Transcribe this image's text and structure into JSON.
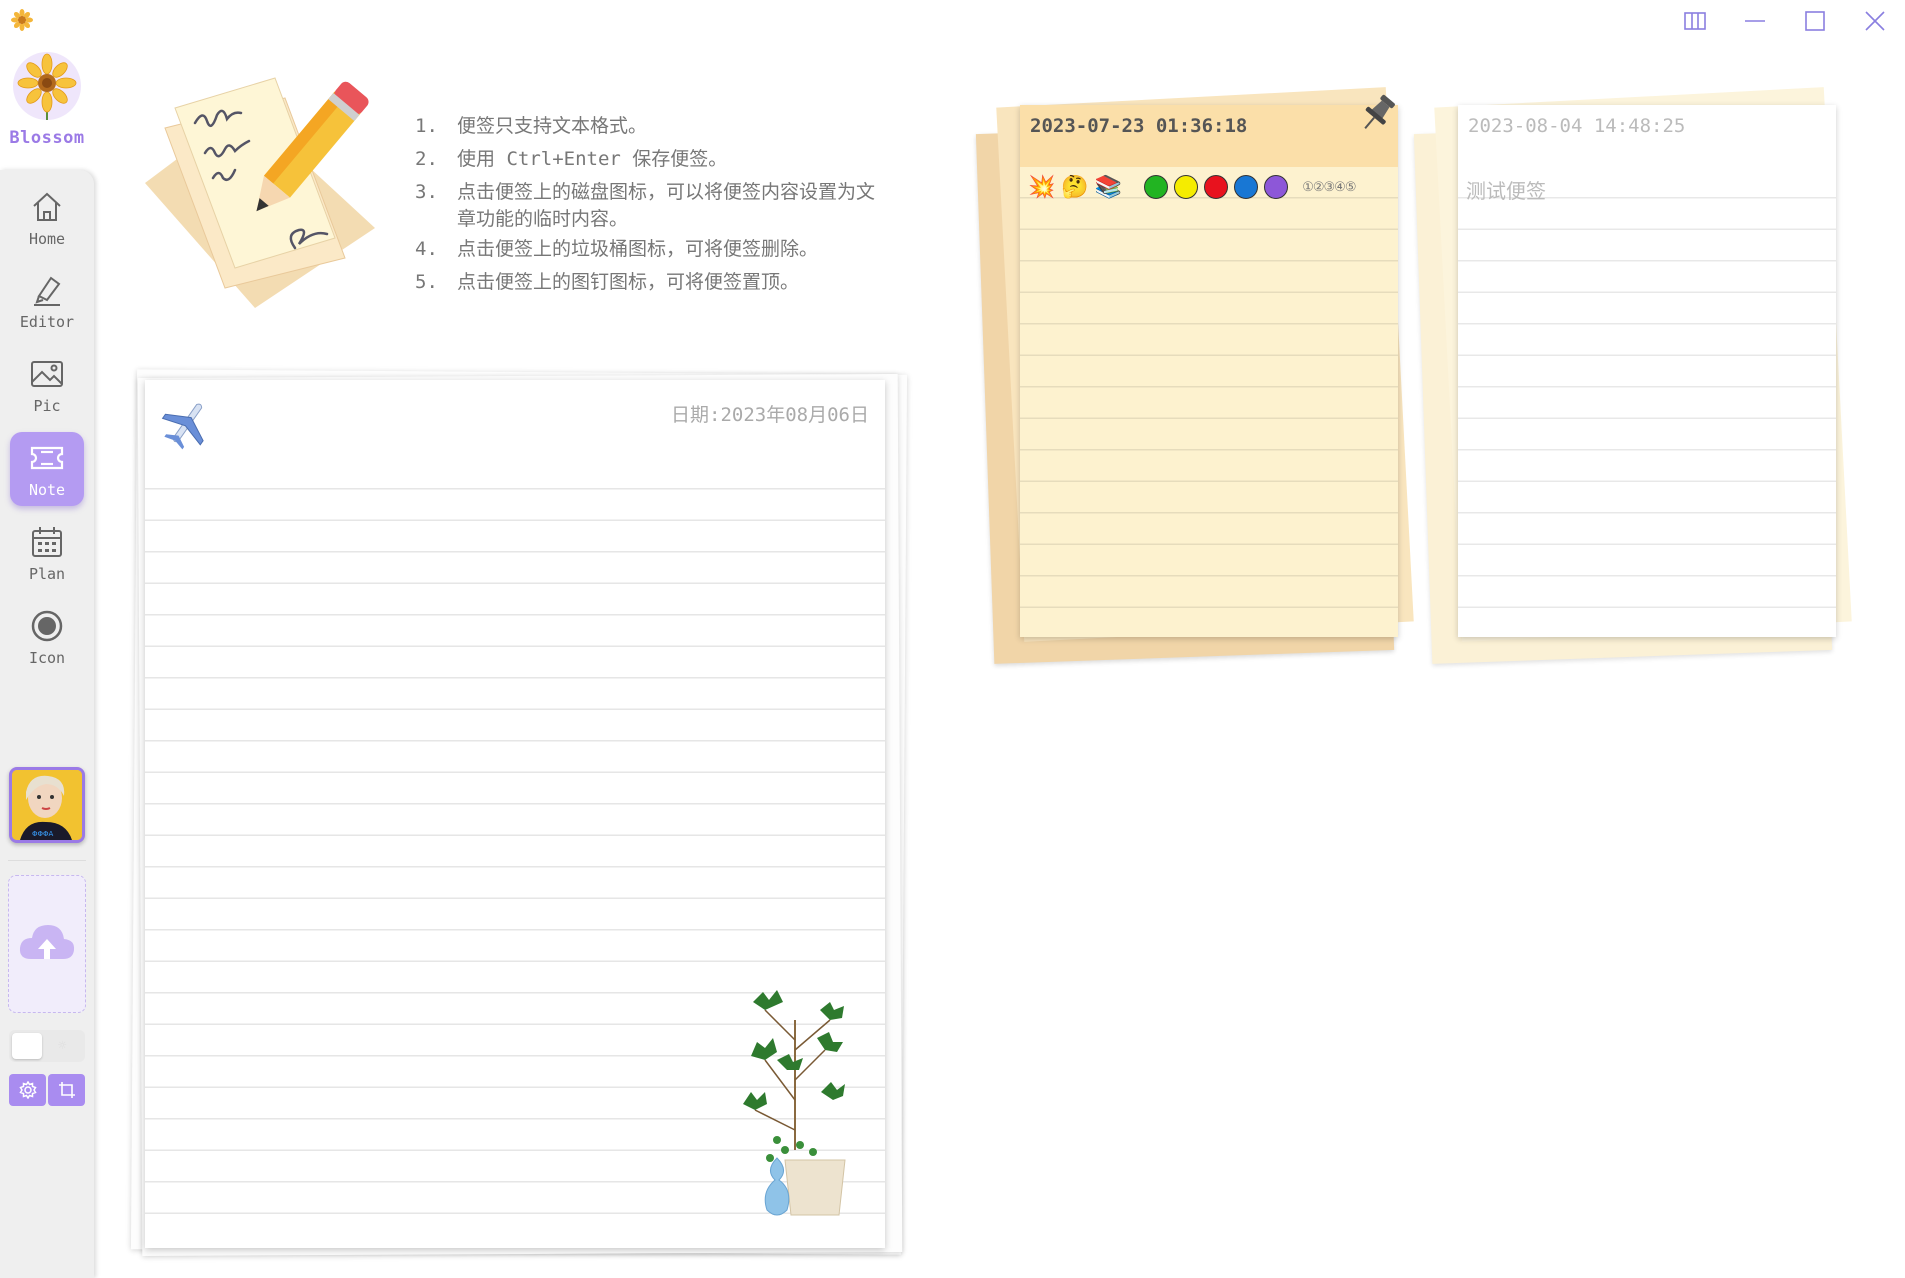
{
  "app": {
    "name": "Blossom",
    "window_controls": [
      "layout-icon",
      "minimize-icon",
      "maximize-icon",
      "close-icon"
    ]
  },
  "sidebar": {
    "items": [
      {
        "label": "Home",
        "icon": "home-icon",
        "active": false
      },
      {
        "label": "Editor",
        "icon": "pen-icon",
        "active": false
      },
      {
        "label": "Pic",
        "icon": "image-icon",
        "active": false
      },
      {
        "label": "Note",
        "icon": "ticket-icon",
        "active": true
      },
      {
        "label": "Plan",
        "icon": "calendar-icon",
        "active": false
      },
      {
        "label": "Icon",
        "icon": "record-icon",
        "active": false
      }
    ],
    "upload_icon": "cloud-upload-icon",
    "theme_icon": "sun-icon",
    "bottom_buttons": [
      "settings-icon",
      "crop-icon"
    ]
  },
  "tips": [
    {
      "num": "1.",
      "text": "便签只支持文本格式。"
    },
    {
      "num": "2.",
      "text": "使用 Ctrl+Enter 保存便签。"
    },
    {
      "num": "3.",
      "text": "点击便签上的磁盘图标，可以将便签内容设置为文章功能的临时内容。"
    },
    {
      "num": "4.",
      "text": "点击便签上的垃圾桶图标，可将便签删除。"
    },
    {
      "num": "5.",
      "text": "点击便签上的图钉图标，可将便签置顶。"
    }
  ],
  "editor_note": {
    "date_text": "日期:2023年08月06日",
    "icon": "airplane-icon",
    "decoration": "plant-image"
  },
  "notes": [
    {
      "timestamp": "2023-07-23 01:36:18",
      "pinned": true,
      "emoji": [
        "💥",
        "🤔",
        "📚"
      ],
      "colors": [
        "#22b422",
        "#f5ec00",
        "#e8121e",
        "#1877d4",
        "#8d57d8"
      ],
      "circled": "①②③④⑤",
      "color": "#fdf2cf"
    },
    {
      "timestamp": "2023-08-04 14:48:25",
      "pinned": false,
      "content": "测试便签",
      "color": "#ffffff"
    }
  ]
}
